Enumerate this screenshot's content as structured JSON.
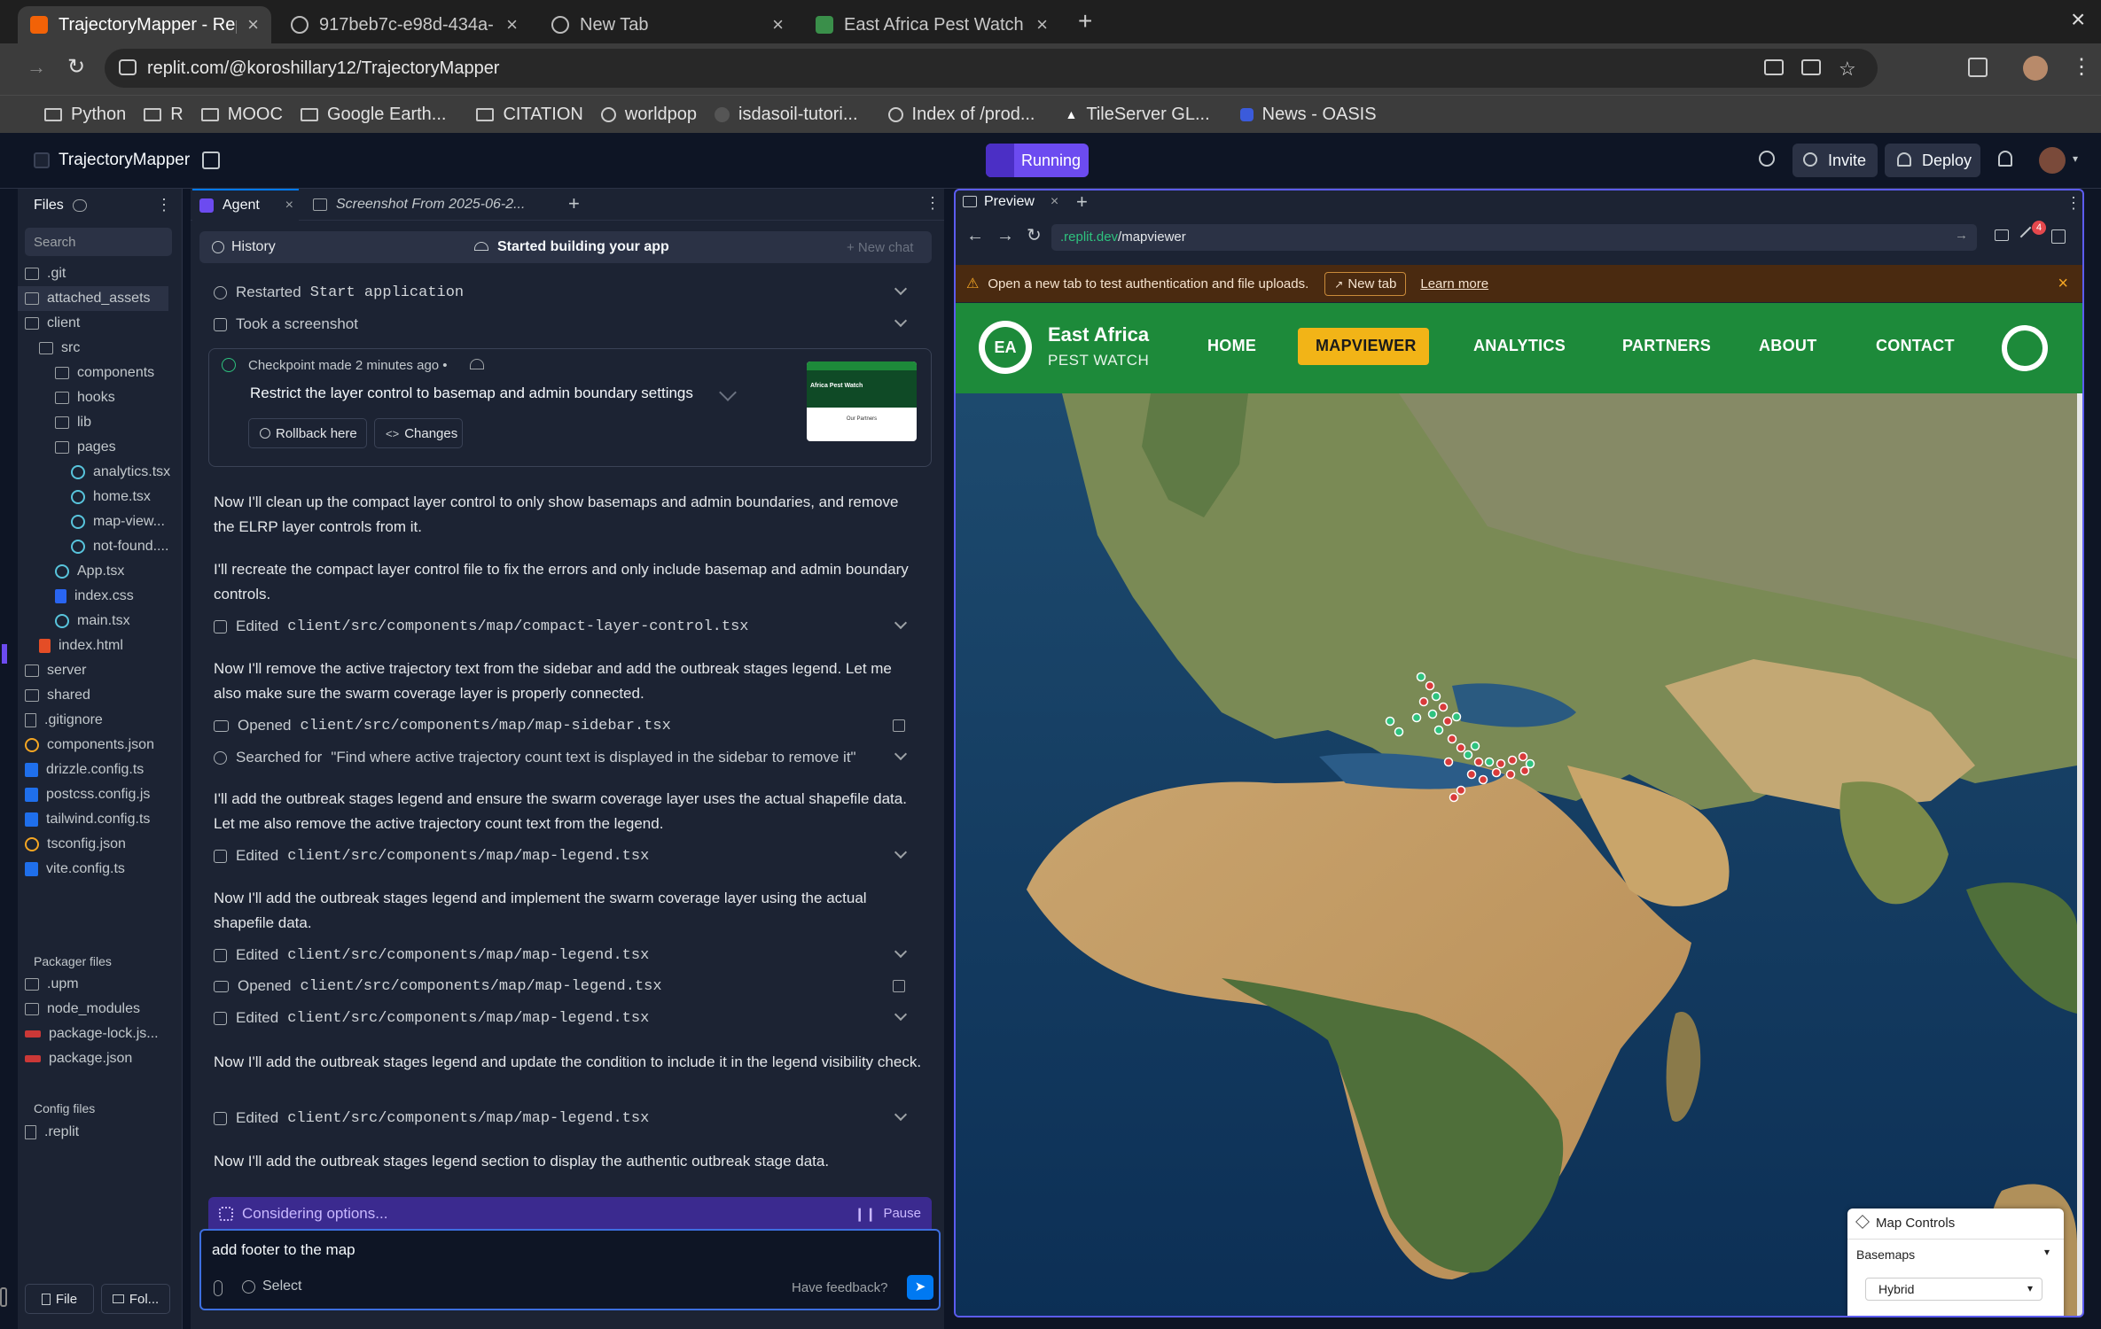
{
  "browser": {
    "tabs": [
      {
        "title": "TrajectoryMapper - Rep",
        "active": true
      },
      {
        "title": "917beb7c-e98d-434a-",
        "active": false
      },
      {
        "title": "New Tab",
        "active": false
      },
      {
        "title": "East Africa Pest Watch",
        "active": false
      }
    ],
    "url": "replit.com/@koroshillary12/TrajectoryMapper",
    "bookmarks": [
      "Python",
      "R",
      "MOOC",
      "Google Earth...",
      "CITATION",
      "worldpop",
      "isdasoil-tutori...",
      "Index of /prod...",
      "TileServer GL...",
      "News - OASIS"
    ]
  },
  "replit": {
    "project_name": "TrajectoryMapper",
    "run_status": "Running",
    "invite_label": "Invite",
    "deploy_label": "Deploy"
  },
  "files": {
    "title": "Files",
    "search_placeholder": "Search",
    "tree": [
      {
        "name": ".git",
        "type": "folder",
        "depth": 0
      },
      {
        "name": "attached_assets",
        "type": "folder",
        "depth": 0,
        "selected": true
      },
      {
        "name": "client",
        "type": "folder",
        "depth": 0
      },
      {
        "name": "src",
        "type": "folder",
        "depth": 1
      },
      {
        "name": "components",
        "type": "folder",
        "depth": 2
      },
      {
        "name": "hooks",
        "type": "folder",
        "depth": 2
      },
      {
        "name": "lib",
        "type": "folder",
        "depth": 2
      },
      {
        "name": "pages",
        "type": "folder",
        "depth": 2
      },
      {
        "name": "analytics.tsx",
        "type": "react",
        "depth": 3
      },
      {
        "name": "home.tsx",
        "type": "react",
        "depth": 3
      },
      {
        "name": "map-view...",
        "type": "react",
        "depth": 3
      },
      {
        "name": "not-found....",
        "type": "react",
        "depth": 3
      },
      {
        "name": "App.tsx",
        "type": "react",
        "depth": 2
      },
      {
        "name": "index.css",
        "type": "css",
        "depth": 2
      },
      {
        "name": "main.tsx",
        "type": "react",
        "depth": 2
      },
      {
        "name": "index.html",
        "type": "html",
        "depth": 1
      },
      {
        "name": "server",
        "type": "folder",
        "depth": 0
      },
      {
        "name": "shared",
        "type": "folder",
        "depth": 0
      },
      {
        "name": ".gitignore",
        "type": "file",
        "depth": 0
      },
      {
        "name": "components.json",
        "type": "json",
        "depth": 0
      },
      {
        "name": "drizzle.config.ts",
        "type": "js",
        "depth": 0
      },
      {
        "name": "postcss.config.js",
        "type": "js",
        "depth": 0
      },
      {
        "name": "tailwind.config.ts",
        "type": "js",
        "depth": 0
      },
      {
        "name": "tsconfig.json",
        "type": "json",
        "depth": 0
      },
      {
        "name": "vite.config.ts",
        "type": "js",
        "depth": 0
      }
    ],
    "packager_title": "Packager files",
    "packager": [
      {
        "name": ".upm",
        "type": "folder"
      },
      {
        "name": "node_modules",
        "type": "folder"
      },
      {
        "name": "package-lock.js...",
        "type": "npm"
      },
      {
        "name": "package.json",
        "type": "npm"
      }
    ],
    "config_title": "Config files",
    "config": [
      {
        "name": ".replit",
        "type": "file"
      }
    ],
    "bottom_file": "File",
    "bottom_folder": "Fol..."
  },
  "agent": {
    "tab_label": "Agent",
    "tab2_label": "Screenshot From 2025-06-2...",
    "history_label": "History",
    "status_label": "Started building your app",
    "new_chat_label": "+ New chat",
    "restarted_prefix": "Restarted",
    "restarted_mono": "Start application",
    "screenshot_label": "Took a screenshot",
    "checkpoint_time": "Checkpoint made 2 minutes ago •",
    "checkpoint_title": "Restrict the layer control to basemap and admin boundary settings",
    "rollback_label": "Rollback here",
    "changes_label": "Changes",
    "thumb_title": "Africa Pest Watch",
    "thumb_sub": "Our Partners",
    "messages": [
      "Now I'll clean up the compact layer control to only show basemaps and admin boundaries, and remove the ELRP layer controls from it.",
      "I'll recreate the compact layer control file to fix the errors and only include basemap and admin boundary controls.",
      "Now I'll remove the active trajectory text from the sidebar and add the outbreak stages legend. Let me also make sure the swarm coverage layer is properly connected.",
      "I'll add the outbreak stages legend and ensure the swarm coverage layer uses the actual shapefile data. Let me also remove the active trajectory count text from the legend.",
      "Now I'll add the outbreak stages legend and implement the swarm coverage layer using the actual shapefile data.",
      "Now I'll add the outbreak stages legend and update the condition to include it in the legend visibility check.",
      "Now I'll add the outbreak stages legend section to display the authentic outbreak stage data."
    ],
    "actions": [
      {
        "verb": "Edited",
        "path": "client/src/components/map/compact-layer-control.tsx"
      },
      {
        "verb": "Opened",
        "path": "client/src/components/map/map-sidebar.tsx"
      },
      {
        "verb": "Searched for",
        "path": "\"Find where active trajectory count text is displayed in the sidebar to remove it\""
      },
      {
        "verb": "Edited",
        "path": "client/src/components/map/map-legend.tsx"
      },
      {
        "verb": "Edited",
        "path": "client/src/components/map/map-legend.tsx"
      },
      {
        "verb": "Opened",
        "path": "client/src/components/map/map-legend.tsx"
      },
      {
        "verb": "Edited",
        "path": "client/src/components/map/map-legend.tsx"
      },
      {
        "verb": "Edited",
        "path": "client/src/components/map/map-legend.tsx"
      }
    ],
    "considering_label": "Considering options...",
    "pause_label": "Pause",
    "input_value": "add footer to the map",
    "select_label": "Select",
    "feedback_label": "Have feedback?"
  },
  "preview": {
    "tab_label": "Preview",
    "url_prefix": ".replit.dev",
    "url_path": "/mapviewer",
    "notice": "Open a new tab to test authentication and file uploads.",
    "new_tab_label": "New tab",
    "learn_more_label": "Learn more",
    "badge_count": "4",
    "site": {
      "logo_initials": "EA",
      "brand_title": "East Africa",
      "brand_subtitle": "PEST WATCH",
      "nav": [
        "HOME",
        "MAPVIEWER",
        "ANALYTICS",
        "PARTNERS",
        "ABOUT",
        "CONTACT"
      ],
      "active_nav": "MAPVIEWER",
      "nav_color": "#1d8a3a",
      "active_color": "#f2b417"
    },
    "map_controls": {
      "title": "Map Controls",
      "basemaps_label": "Basemaps",
      "basemap_value": "Hybrid"
    }
  }
}
